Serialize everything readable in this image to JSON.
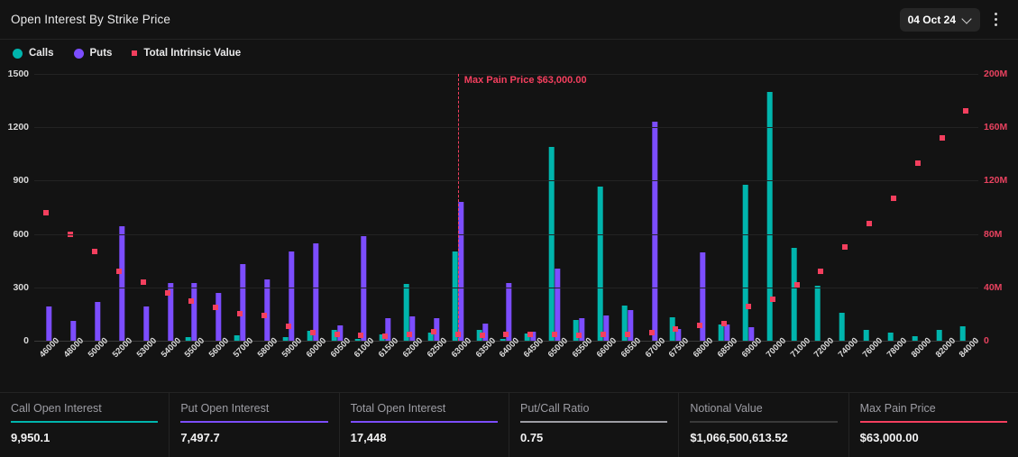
{
  "header": {
    "title": "Open Interest By Strike Price",
    "date_label": "04 Oct 24",
    "chevron_icon": "chevron-down-icon",
    "menu_icon": "kebab-menu-icon"
  },
  "legend": [
    {
      "label": "Calls",
      "color": "#00b5ad",
      "marker": "circle"
    },
    {
      "label": "Puts",
      "color": "#7c4dff",
      "marker": "circle"
    },
    {
      "label": "Total Intrinsic Value",
      "color": "#f43f5e",
      "marker": "square"
    }
  ],
  "annotation": {
    "text": "Max Pain Price $63,000.00",
    "strike": "63000",
    "color": "#f43f5e"
  },
  "stats": [
    {
      "label": "Call Open Interest",
      "value": "9,950.1",
      "accent": "#00b5ad"
    },
    {
      "label": "Put Open Interest",
      "value": "7,497.7",
      "accent": "#7c4dff"
    },
    {
      "label": "Total Open Interest",
      "value": "17,448",
      "accent": "#7c4dff"
    },
    {
      "label": "Put/Call Ratio",
      "value": "0.75",
      "accent": "#9d9da4"
    },
    {
      "label": "Notional Value",
      "value": "$1,066,500,613.52",
      "accent": "#3a3a3a"
    },
    {
      "label": "Max Pain Price",
      "value": "$63,000.00",
      "accent": "#f43f5e"
    }
  ],
  "chart_data": {
    "type": "bar",
    "title": "Open Interest By Strike Price",
    "xlabel": "",
    "ylabel": "Open Interest",
    "y2label": "Total Intrinsic Value",
    "ylim": [
      0,
      1500
    ],
    "y2lim": [
      0,
      200000000
    ],
    "yticks": [
      "0",
      "300",
      "600",
      "900",
      "1200",
      "1500"
    ],
    "y2ticks": [
      "0",
      "40M",
      "80M",
      "120M",
      "160M",
      "200M"
    ],
    "grid": true,
    "legend_position": "top-left",
    "categories": [
      "46000",
      "48000",
      "50000",
      "52000",
      "53000",
      "54000",
      "55000",
      "56000",
      "57000",
      "58000",
      "59000",
      "60000",
      "60500",
      "61000",
      "61500",
      "62000",
      "62500",
      "63000",
      "63500",
      "64000",
      "64500",
      "65000",
      "65500",
      "66000",
      "66500",
      "67000",
      "67500",
      "68000",
      "68500",
      "69000",
      "70000",
      "71000",
      "72000",
      "74000",
      "76000",
      "78000",
      "80000",
      "82000",
      "84000"
    ],
    "series": [
      {
        "name": "Calls",
        "color": "#00b5ad",
        "axis": "left",
        "values": [
          0,
          0,
          0,
          0,
          0,
          0,
          18,
          0,
          28,
          0,
          20,
          55,
          62,
          10,
          35,
          320,
          48,
          500,
          62,
          8,
          40,
          1090,
          117,
          865,
          200,
          0,
          130,
          0,
          90,
          875,
          1400,
          520,
          310,
          155,
          60,
          45,
          25,
          60,
          80
        ]
      },
      {
        "name": "Puts",
        "color": "#7c4dff",
        "axis": "left",
        "values": [
          192,
          110,
          218,
          645,
          192,
          323,
          323,
          268,
          430,
          345,
          502,
          548,
          88,
          588,
          128,
          138,
          128,
          780,
          95,
          323,
          52,
          405,
          125,
          140,
          170,
          1232,
          65,
          495,
          90,
          78,
          0,
          0,
          0,
          0,
          0,
          0,
          0,
          0,
          0
        ]
      },
      {
        "name": "Total Intrinsic Value",
        "color": "#f43f5e",
        "axis": "right",
        "type": "scatter",
        "values": [
          96000000,
          80000000,
          67000000,
          52000000,
          44000000,
          36000000,
          30000000,
          25000000,
          20000000,
          19000000,
          11000000,
          6000000,
          5000000,
          4000000,
          3500000,
          5000000,
          7000000,
          5000000,
          4000000,
          5000000,
          4500000,
          5000000,
          4000000,
          4500000,
          4500000,
          6000000,
          9000000,
          11500000,
          13000000,
          26000000,
          31000000,
          42000000,
          52000000,
          70000000,
          88000000,
          107000000,
          133000000,
          152000000,
          172000000
        ]
      }
    ]
  }
}
